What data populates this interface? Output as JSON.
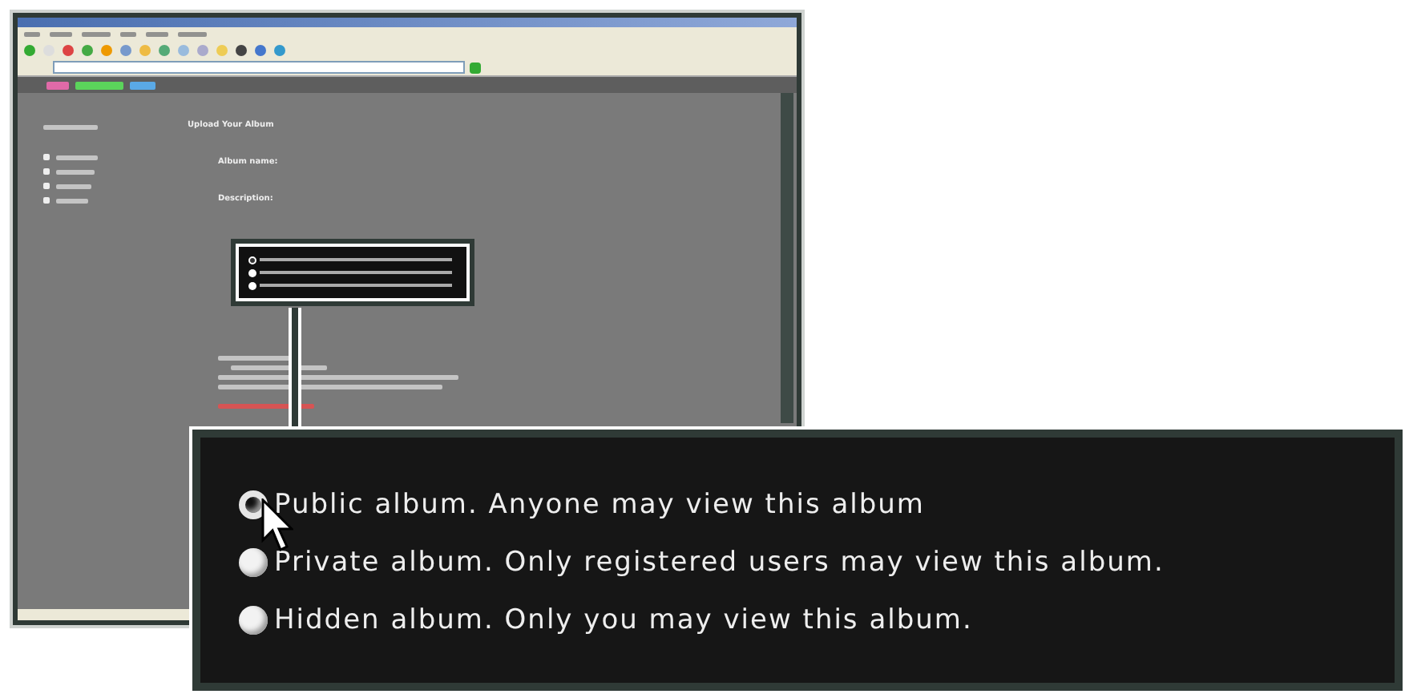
{
  "page": {
    "heading": "Upload Your Album",
    "fields": [
      "Album name:",
      "Description:"
    ]
  },
  "callout": {
    "options": [
      {
        "label": "Public album. Anyone may view this album",
        "selected": true
      },
      {
        "label": "Private album. Only registered users may view this album.",
        "selected": false
      },
      {
        "label": "Hidden album. Only you may view this album.",
        "selected": false
      }
    ]
  }
}
